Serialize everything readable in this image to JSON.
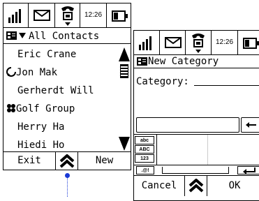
{
  "left_screen": {
    "status": {
      "time": "12:26"
    },
    "header": {
      "title": "All Contacts"
    },
    "contacts": [
      {
        "name": "Eric Crane",
        "icon": "none"
      },
      {
        "name": "Jon Mak",
        "icon": "phone-icon"
      },
      {
        "name": "Gerherdt Will",
        "icon": "none"
      },
      {
        "name": "Golf Group",
        "icon": "group-icon"
      },
      {
        "name": "Herry Ha",
        "icon": "none"
      },
      {
        "name": "Hiedi Ho",
        "icon": "none"
      }
    ],
    "softkeys": {
      "left": "Exit",
      "right": "New"
    }
  },
  "right_screen": {
    "status": {
      "time": "12:26"
    },
    "header": {
      "title": "New Category"
    },
    "form": {
      "category_label": "Category:"
    },
    "keyboard_modes": [
      "abc",
      "ABC",
      "123"
    ],
    "keyboard_symbols": ".@!",
    "softkeys": {
      "left": "Cancel",
      "right": "OK"
    }
  }
}
